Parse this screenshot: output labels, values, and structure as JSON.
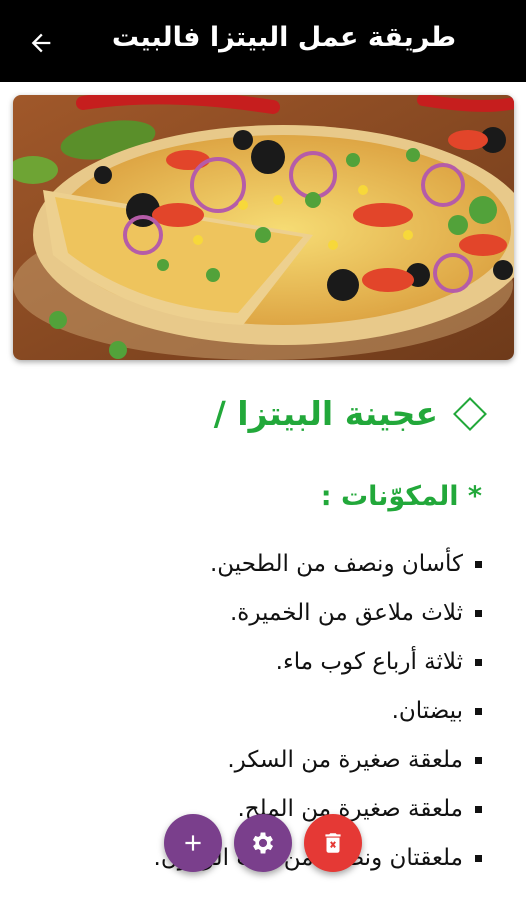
{
  "appbar": {
    "title": "طريقة عمل البيتزا فالبيت",
    "back_icon": "arrow-back-icon"
  },
  "hero": {
    "image": "pizza-photo",
    "colors": {
      "wood": "#8a4b22",
      "crust": "#e8c98a",
      "cheese": "#f4d35e"
    }
  },
  "section": {
    "heading": "عجينة البيتزا /",
    "heading_icon": "diamond-outline-icon",
    "color": "#22a83a"
  },
  "ingredients": {
    "heading": "* المكوّنات :",
    "items": [
      "كأسان ونصف من الطحين.",
      "ثلاث ملاعق من الخميرة.",
      "ثلاثة أرباع كوب ماء.",
      "بيضتان.",
      "ملعقة صغيرة من السكر.",
      "ملعقة صغيرة من الملح.",
      "ملعقتان ونصف من زيت الزيتون."
    ]
  },
  "fabs": {
    "add": {
      "icon": "plus-icon",
      "color": "#7a3f8c"
    },
    "settings": {
      "icon": "gear-icon",
      "color": "#7a3f8c"
    },
    "delete": {
      "icon": "trash-icon",
      "color": "#e53935"
    }
  }
}
